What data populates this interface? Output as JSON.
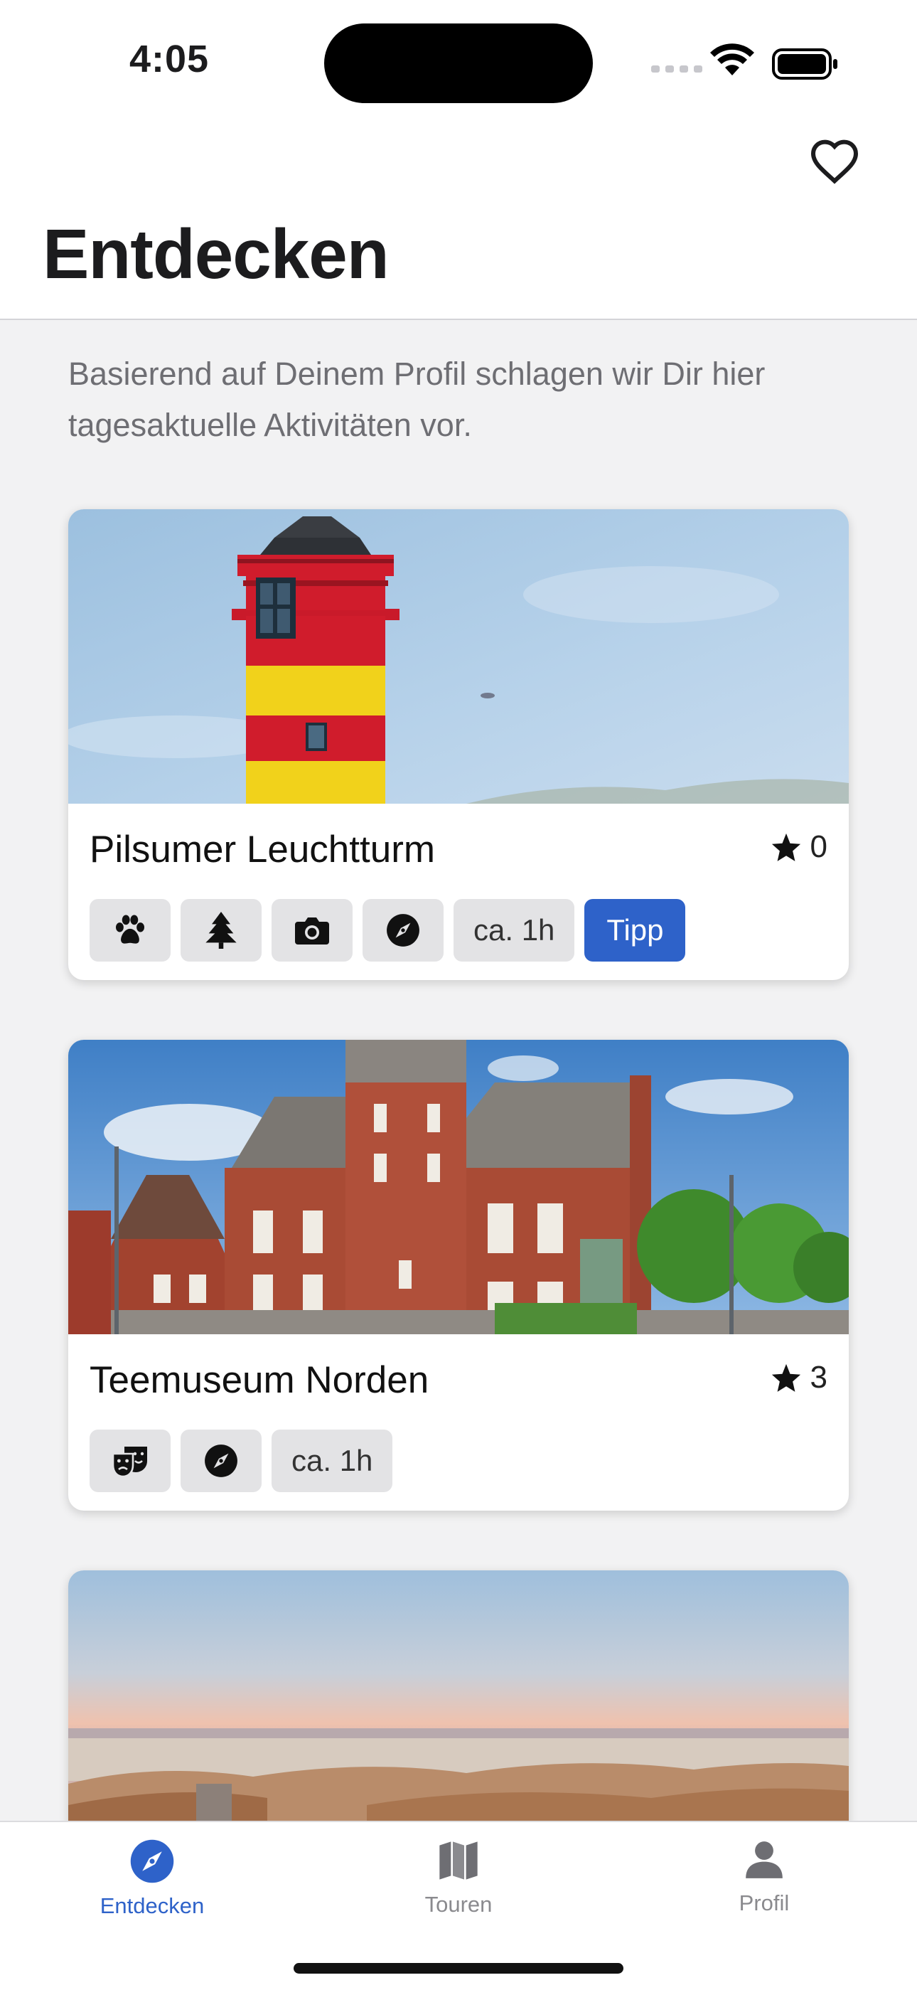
{
  "status_bar": {
    "time": "4:05"
  },
  "header": {
    "title": "Entdecken",
    "favorite_icon": "heart-outline-icon"
  },
  "intro_text": "Basierend auf Deinem Profil schlagen wir Dir hier tagesaktuelle Aktivitäten vor.",
  "cards": [
    {
      "title": "Pilsumer Leuchtturm",
      "rating": "0",
      "tags": [
        {
          "icon": "paw-icon"
        },
        {
          "icon": "tree-icon"
        },
        {
          "icon": "camera-icon"
        },
        {
          "icon": "compass-icon"
        },
        {
          "label": "ca. 1h"
        },
        {
          "label": "Tipp",
          "highlight": true
        }
      ]
    },
    {
      "title": "Teemuseum Norden",
      "rating": "3",
      "tags": [
        {
          "icon": "theater-masks-icon"
        },
        {
          "icon": "compass-icon"
        },
        {
          "label": "ca. 1h"
        }
      ]
    },
    {
      "title": "",
      "image": "beach-sunset-image"
    }
  ],
  "tabbar": {
    "tabs": [
      {
        "label": "Entdecken",
        "icon": "compass-icon",
        "active": true
      },
      {
        "label": "Touren",
        "icon": "map-icon",
        "active": false
      },
      {
        "label": "Profil",
        "icon": "person-icon",
        "active": false
      }
    ]
  },
  "colors": {
    "accent": "#2e62c9",
    "tag_bg": "#e3e3e5",
    "background": "#f2f2f3"
  }
}
